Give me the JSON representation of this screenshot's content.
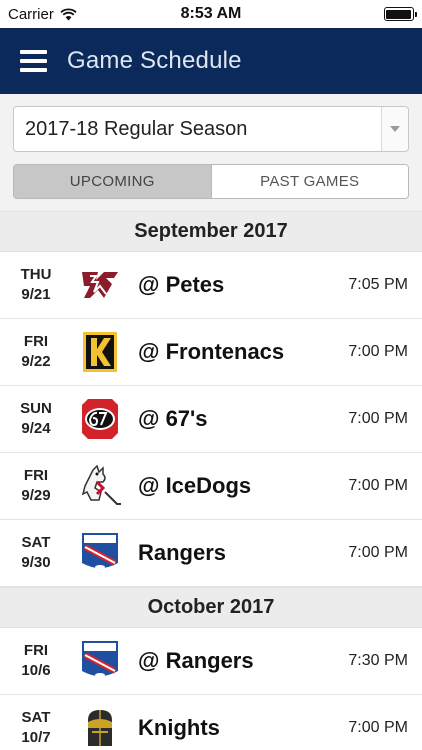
{
  "status_bar": {
    "carrier": "Carrier",
    "time": "8:53 AM"
  },
  "nav": {
    "title": "Game Schedule"
  },
  "season_select": {
    "selected": "2017-18 Regular Season"
  },
  "tabs": [
    {
      "label": "UPCOMING",
      "active": true
    },
    {
      "label": "PAST GAMES",
      "active": false
    }
  ],
  "months": [
    {
      "label": "September 2017",
      "games": [
        {
          "day": "THU",
          "date": "9/21",
          "opponent": "@ Petes",
          "time": "7:05 PM",
          "logo": "petes-logo"
        },
        {
          "day": "FRI",
          "date": "9/22",
          "opponent": "@ Frontenacs",
          "time": "7:00 PM",
          "logo": "frontenacs-logo"
        },
        {
          "day": "SUN",
          "date": "9/24",
          "opponent": "@ 67's",
          "time": "7:00 PM",
          "logo": "67s-logo"
        },
        {
          "day": "FRI",
          "date": "9/29",
          "opponent": "@ IceDogs",
          "time": "7:00 PM",
          "logo": "icedogs-logo"
        },
        {
          "day": "SAT",
          "date": "9/30",
          "opponent": "Rangers",
          "time": "7:00 PM",
          "logo": "rangers-logo"
        }
      ]
    },
    {
      "label": "October 2017",
      "games": [
        {
          "day": "FRI",
          "date": "10/6",
          "opponent": "@ Rangers",
          "time": "7:30 PM",
          "logo": "rangers-logo"
        },
        {
          "day": "SAT",
          "date": "10/7",
          "opponent": "Knights",
          "time": "7:00 PM",
          "logo": "knights-logo"
        }
      ]
    }
  ],
  "colors": {
    "nav_bg": "#0b2a5b",
    "month_header_bg": "#ececec",
    "active_tab_bg": "#c7c7c7"
  }
}
